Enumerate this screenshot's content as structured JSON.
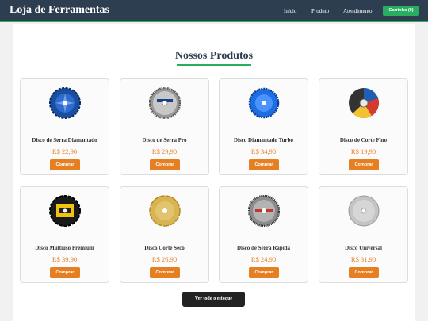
{
  "header": {
    "logo": "Loja de Ferramentas",
    "nav": [
      "Início",
      "Produto",
      "Atendimento"
    ],
    "cart": "Carrinho (0)"
  },
  "main": {
    "title": "Nossos Produtos",
    "buy_label": "Comprar",
    "view_all": "Ver todo o estoque",
    "products": [
      {
        "name": "Disco de Serra Diamantado",
        "price": "R$ 22,90"
      },
      {
        "name": "Disco de Serra Pro",
        "price": "R$ 29,90"
      },
      {
        "name": "Disco Diamantado Turbo",
        "price": "R$ 34,90"
      },
      {
        "name": "Disco de Corte Fino",
        "price": "R$ 19,90"
      },
      {
        "name": "Disco Multiuso Premium",
        "price": "R$ 39,90"
      },
      {
        "name": "Disco Corte Seco",
        "price": "R$ 26,90"
      },
      {
        "name": "Disco de Serra Rápida",
        "price": "R$ 24,90"
      },
      {
        "name": "Disco Universal",
        "price": "R$ 31,90"
      }
    ]
  },
  "colors": {
    "header_bg": "#2c3e50",
    "accent_green": "#27ae60",
    "accent_orange": "#e67e22",
    "dark_button": "#222222"
  },
  "icons": [
    "diamond-blade-icon",
    "saw-blade-icon",
    "turbo-blade-icon",
    "cutting-disc-icon",
    "multi-blade-icon",
    "segmented-blade-icon",
    "rapid-saw-icon",
    "plain-blade-icon"
  ]
}
